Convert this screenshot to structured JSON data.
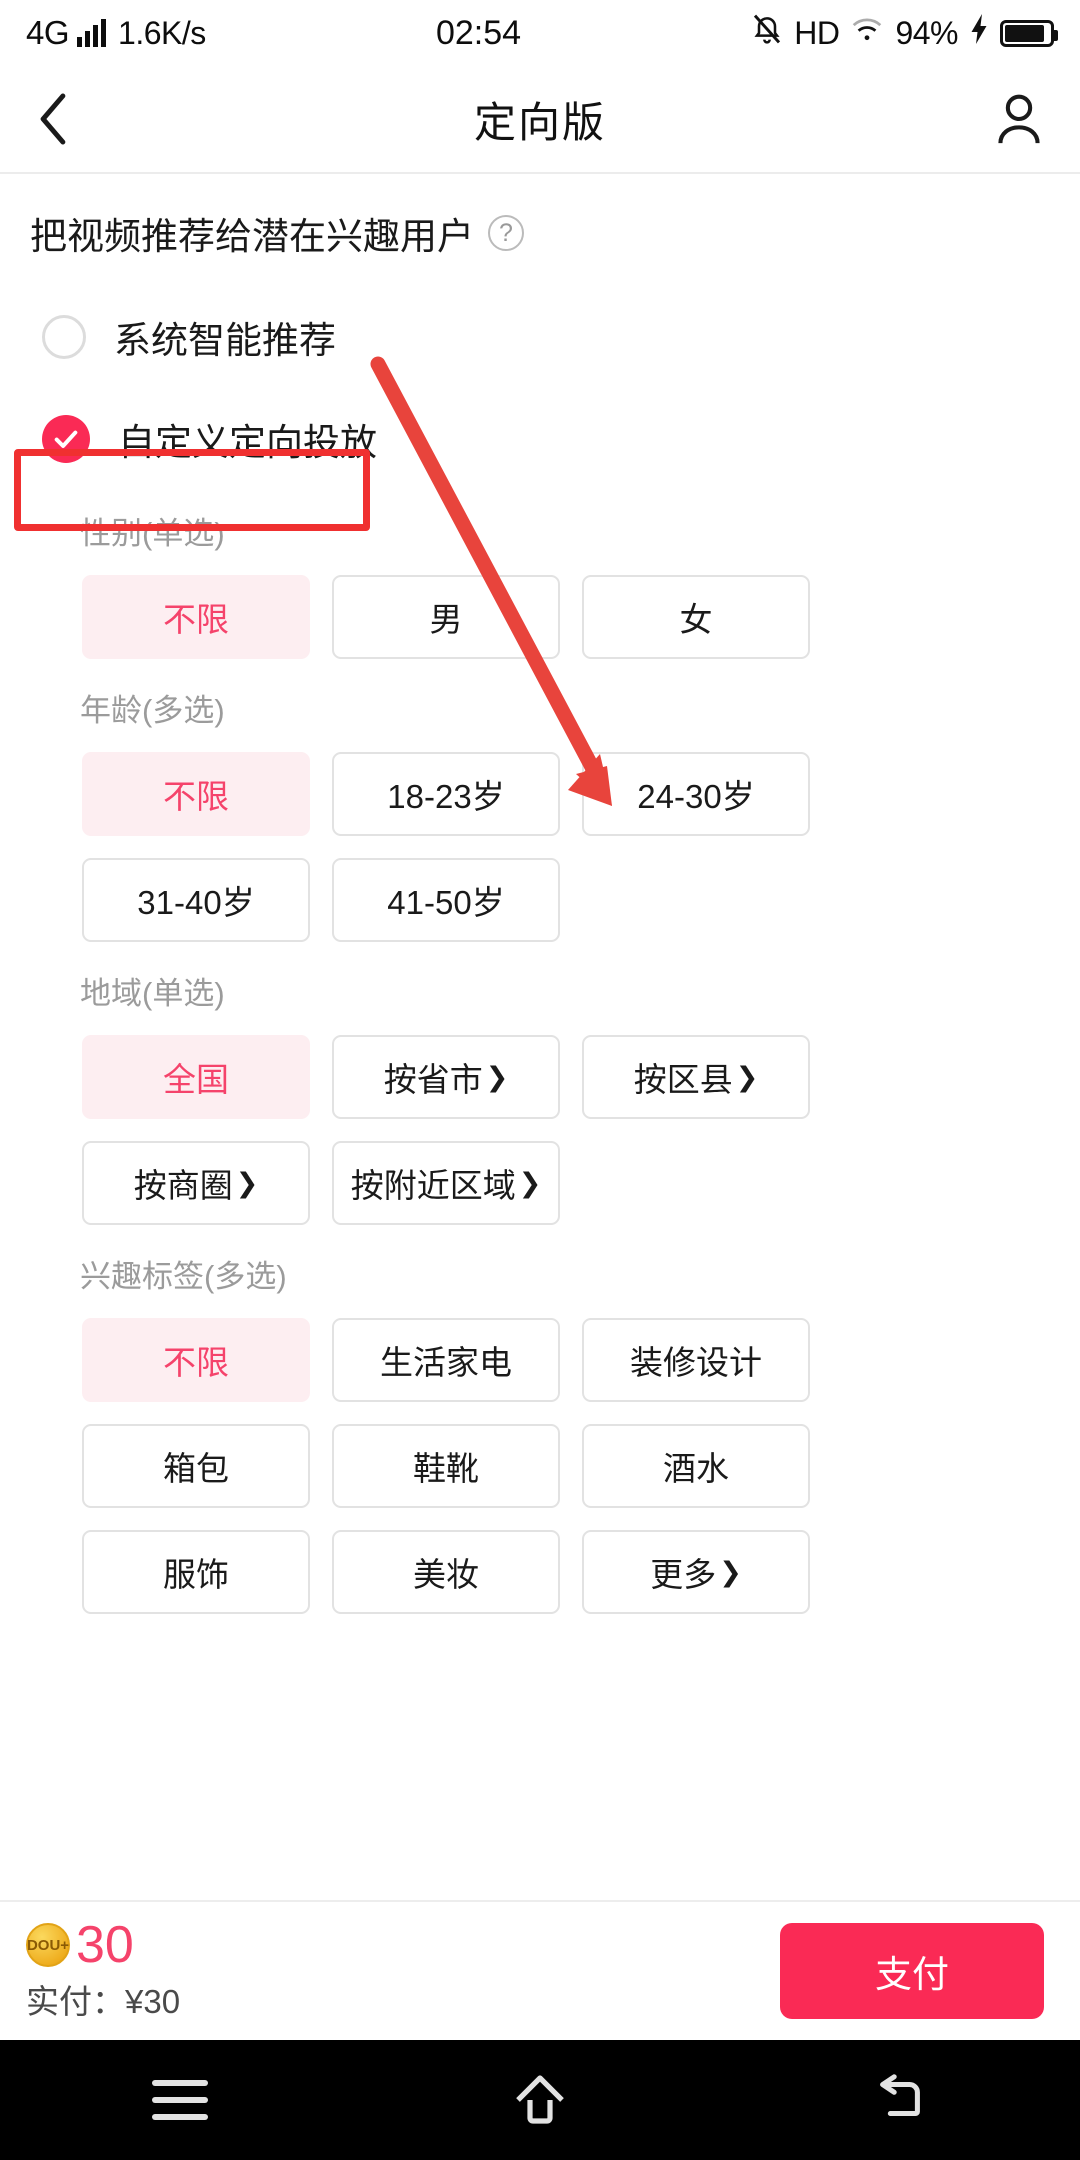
{
  "statusbar": {
    "network": "4G",
    "speed": "1.6K/s",
    "time": "02:54",
    "hd": "HD",
    "battery_pct": "94%",
    "signal_icon": "signal-bars-icon",
    "mute_icon": "bell-muted-icon",
    "wifi_icon": "wifi-icon",
    "charging_icon": "lightning-bolt-icon",
    "battery_icon": "battery-icon"
  },
  "titlebar": {
    "back_icon": "back-chevron-icon",
    "title": "定向版",
    "account_icon": "person-icon"
  },
  "subhead": {
    "text": "把视频推荐给潜在兴趣用户",
    "help_icon": "question-mark-icon",
    "help_glyph": "?"
  },
  "modes": [
    {
      "label": "系统智能推荐",
      "selected": false
    },
    {
      "label": "自定义定向投放",
      "selected": true
    }
  ],
  "annotations": {
    "box_color": "#f03030",
    "arrow_color": "#e8443c",
    "box_target": "自定义定向投放",
    "arrow_target": "按区县"
  },
  "groups": [
    {
      "label": "性别(单选)",
      "chips": [
        {
          "label": "不限",
          "active": true,
          "caret": false
        },
        {
          "label": "男",
          "active": false,
          "caret": false
        },
        {
          "label": "女",
          "active": false,
          "caret": false
        }
      ]
    },
    {
      "label": "年龄(多选)",
      "chips": [
        {
          "label": "不限",
          "active": true,
          "caret": false
        },
        {
          "label": "18-23岁",
          "active": false,
          "caret": false
        },
        {
          "label": "24-30岁",
          "active": false,
          "caret": false
        },
        {
          "label": "31-40岁",
          "active": false,
          "caret": false
        },
        {
          "label": "41-50岁",
          "active": false,
          "caret": false
        }
      ]
    },
    {
      "label": "地域(单选)",
      "chips": [
        {
          "label": "全国",
          "active": true,
          "caret": false
        },
        {
          "label": "按省市",
          "active": false,
          "caret": true
        },
        {
          "label": "按区县",
          "active": false,
          "caret": true
        },
        {
          "label": "按商圈",
          "active": false,
          "caret": true
        },
        {
          "label": "按附近区域",
          "active": false,
          "caret": true
        }
      ]
    },
    {
      "label": "兴趣标签(多选)",
      "chips": [
        {
          "label": "不限",
          "active": true,
          "caret": false
        },
        {
          "label": "生活家电",
          "active": false,
          "caret": false
        },
        {
          "label": "装修设计",
          "active": false,
          "caret": false
        },
        {
          "label": "箱包",
          "active": false,
          "caret": false
        },
        {
          "label": "鞋靴",
          "active": false,
          "caret": false
        },
        {
          "label": "酒水",
          "active": false,
          "caret": false
        },
        {
          "label": "服饰",
          "active": false,
          "caret": false
        },
        {
          "label": "美妆",
          "active": false,
          "caret": false
        },
        {
          "label": "更多",
          "active": false,
          "caret": true
        }
      ]
    }
  ],
  "bottombar": {
    "coin_icon": "dou-plus-coin-icon",
    "coin_text": "DOU+",
    "coin_amount": "30",
    "paid_label": "实付：¥30",
    "pay_label": "支付",
    "accent_color": "#fa2a55"
  },
  "navbar": {
    "menu_icon": "menu-icon",
    "home_icon": "home-icon",
    "back_icon": "back-arrow-icon"
  }
}
